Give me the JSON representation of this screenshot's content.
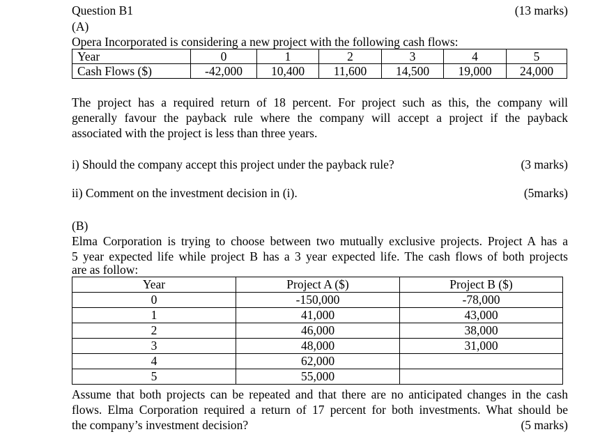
{
  "header": {
    "title": "Question B1",
    "total_marks": "(13 marks)"
  },
  "part_a": {
    "label": "(A)",
    "intro": "Opera Incorporated is considering a new project with the following cash flows:",
    "table": {
      "row_labels": [
        "Year",
        "Cash Flows ($)"
      ],
      "years": [
        "0",
        "1",
        "2",
        "3",
        "4",
        "5"
      ],
      "cash_flows": [
        "-42,000",
        "10,400",
        "11,600",
        "14,500",
        "19,000",
        "24,000"
      ]
    },
    "paragraph_lines": [
      "The project has a required return of 18 percent. For project such as this, the company will",
      "generally favour the payback rule where the company will accept a project if the payback",
      "associated with the project is less than three years."
    ],
    "questions": [
      {
        "text": "i) Should the company accept this project under the payback rule?",
        "marks": "(3 marks)"
      },
      {
        "text": "ii) Comment on the investment decision in (i).",
        "marks": "(5marks)"
      }
    ]
  },
  "part_b": {
    "label": "(B)",
    "intro_lines": [
      "Elma Corporation is trying to choose between two mutually exclusive projects. Project A has a",
      "5 year expected life while project B has a 3 year expected life. The cash flows of both projects",
      "are as follow:"
    ],
    "table": {
      "headers": [
        "Year",
        "Project A ($)",
        "Project B ($)"
      ],
      "rows": [
        [
          "0",
          "-150,000",
          "-78,000"
        ],
        [
          "1",
          "41,000",
          "43,000"
        ],
        [
          "2",
          "46,000",
          "38,000"
        ],
        [
          "3",
          "48,000",
          "31,000"
        ],
        [
          "4",
          "62,000",
          ""
        ],
        [
          "5",
          "55,000",
          ""
        ]
      ]
    },
    "closing_lines": [
      "Assume that both projects can be repeated and that there are no anticipated changes in the cash",
      "flows. Elma Corporation required a return of 17 percent for both investments. What should be",
      "the company’s investment decision?"
    ],
    "marks": "(5 marks)"
  }
}
